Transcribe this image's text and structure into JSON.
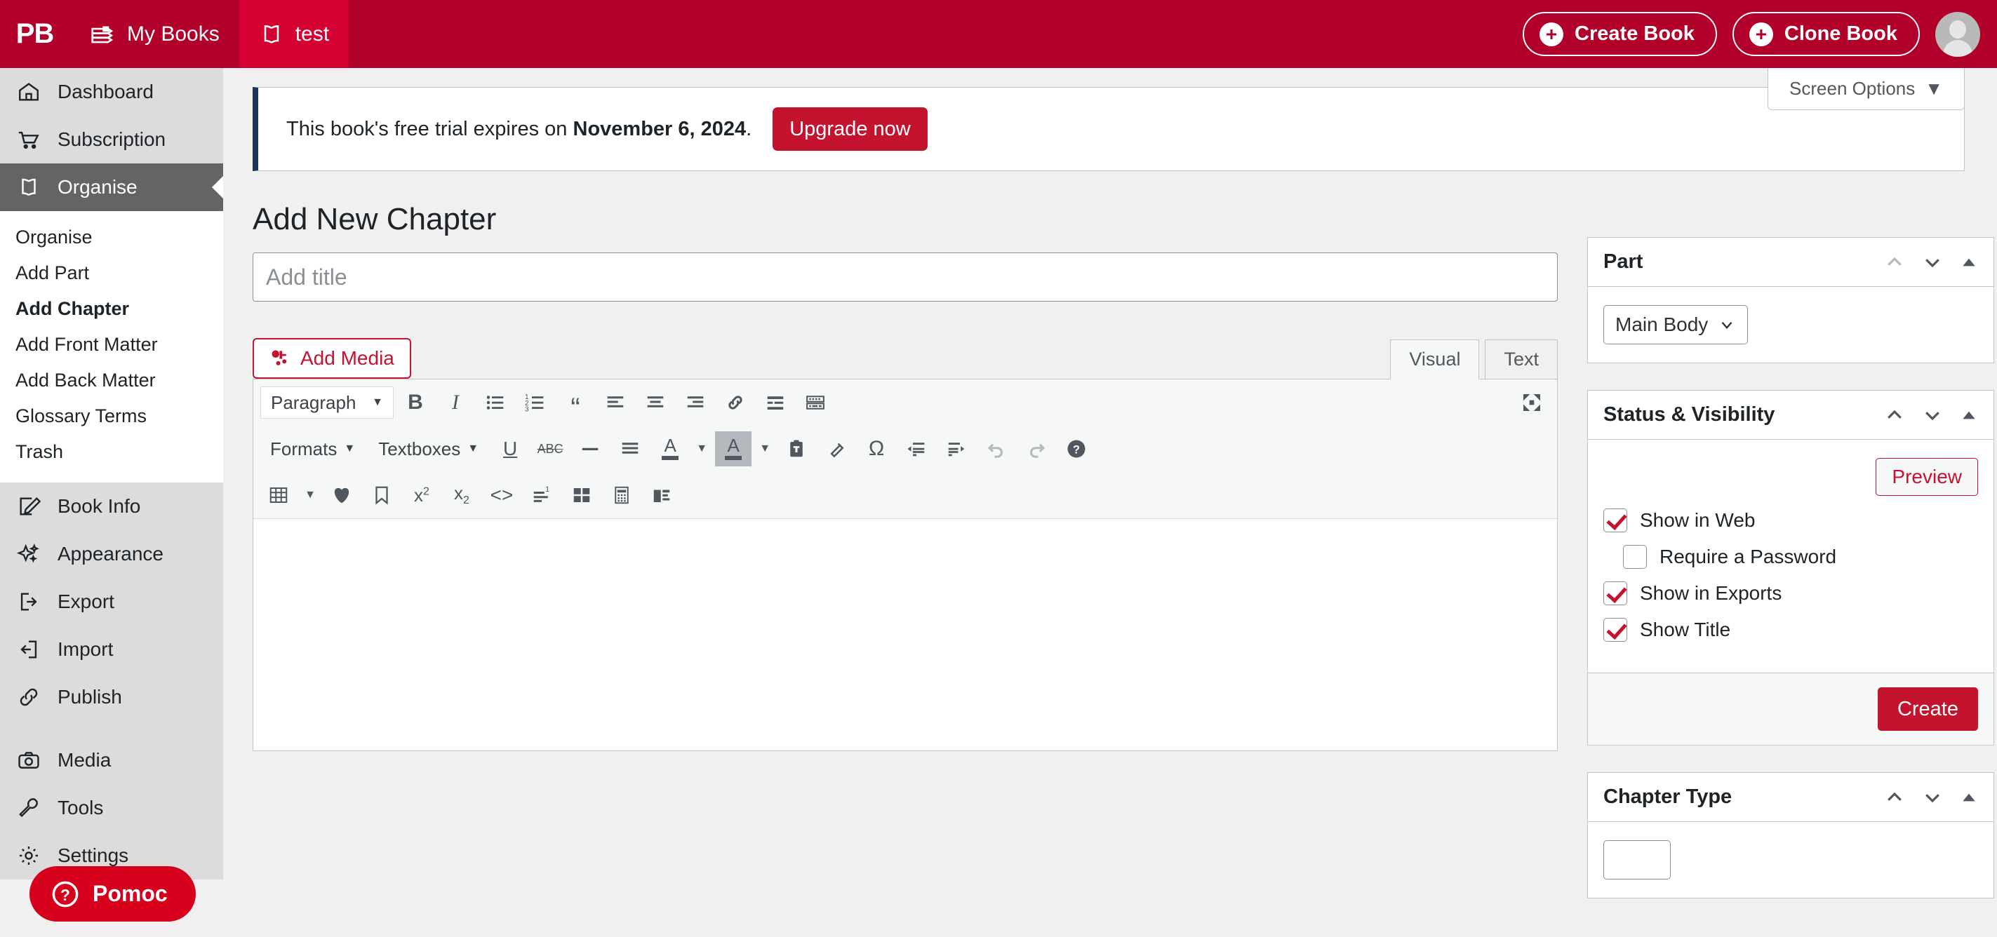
{
  "adminbar": {
    "logo": "PB",
    "items": [
      {
        "label": "My Books",
        "icon": "books-icon"
      },
      {
        "label": "test",
        "icon": "open-book-icon"
      }
    ],
    "create_book": "Create Book",
    "clone_book": "Clone Book",
    "avatar": "user-avatar",
    "brand_color": "#b10029",
    "current_color": "#d40032"
  },
  "screen_options": {
    "label": "Screen Options",
    "caret": "▼"
  },
  "sidebar": {
    "top_items": [
      {
        "label": "Dashboard",
        "icon": "home-icon"
      },
      {
        "label": "Subscription",
        "icon": "cart-icon"
      }
    ],
    "active_item": {
      "label": "Organise",
      "icon": "open-book-icon"
    },
    "submenu": [
      {
        "label": "Organise",
        "current": false
      },
      {
        "label": "Add Part",
        "current": false
      },
      {
        "label": "Add Chapter",
        "current": true
      },
      {
        "label": "Add Front Matter",
        "current": false
      },
      {
        "label": "Add Back Matter",
        "current": false
      },
      {
        "label": "Glossary Terms",
        "current": false
      },
      {
        "label": "Trash",
        "current": false
      }
    ],
    "bottom_items": [
      {
        "label": "Book Info",
        "icon": "pencil-square-icon"
      },
      {
        "label": "Appearance",
        "icon": "sparkles-icon"
      },
      {
        "label": "Export",
        "icon": "export-icon"
      },
      {
        "label": "Import",
        "icon": "import-icon"
      },
      {
        "label": "Publish",
        "icon": "link-chain-icon"
      },
      {
        "label": "Media",
        "icon": "camera-icon"
      },
      {
        "label": "Tools",
        "icon": "wrench-icon"
      },
      {
        "label": "Settings",
        "icon": "gear-icon"
      }
    ]
  },
  "notice": {
    "text_before": "This book's free trial expires on ",
    "date": "November 6, 2024",
    "text_after": ".",
    "upgrade_label": "Upgrade now",
    "accent": "#1d3557"
  },
  "page": {
    "title": "Add New Chapter"
  },
  "title_field": {
    "value": "",
    "placeholder": "Add title"
  },
  "editor": {
    "add_media": "Add Media",
    "tabs": [
      {
        "label": "Visual",
        "active": true
      },
      {
        "label": "Text",
        "active": false
      }
    ],
    "row1": {
      "format_select": "Paragraph",
      "buttons": [
        {
          "name": "bold-icon",
          "glyph": "B"
        },
        {
          "name": "italic-icon",
          "glyph": "I"
        },
        {
          "name": "bulleted-list-icon",
          "glyph": ""
        },
        {
          "name": "numbered-list-icon",
          "glyph": ""
        },
        {
          "name": "blockquote-icon",
          "glyph": "“"
        },
        {
          "name": "align-left-icon",
          "glyph": ""
        },
        {
          "name": "align-center-icon",
          "glyph": ""
        },
        {
          "name": "align-right-icon",
          "glyph": ""
        },
        {
          "name": "insert-link-icon",
          "glyph": ""
        },
        {
          "name": "read-more-icon",
          "glyph": ""
        },
        {
          "name": "keyboard-shortcuts-icon",
          "glyph": ""
        }
      ],
      "fullscreen": "fullscreen-icon"
    },
    "row2": {
      "formats_menu": "Formats",
      "textboxes_menu": "Textboxes",
      "buttons": [
        {
          "name": "underline-icon",
          "glyph": "U"
        },
        {
          "name": "strikethrough-icon",
          "glyph": "ABC"
        },
        {
          "name": "horizontal-rule-icon",
          "glyph": "—"
        },
        {
          "name": "justify-icon",
          "glyph": ""
        },
        {
          "name": "text-color-icon",
          "glyph": "A"
        },
        {
          "name": "background-color-icon",
          "glyph": "A",
          "active": true
        },
        {
          "name": "paste-as-text-icon",
          "glyph": ""
        },
        {
          "name": "clear-formatting-icon",
          "glyph": ""
        },
        {
          "name": "special-character-icon",
          "glyph": "Ω"
        },
        {
          "name": "outdent-icon",
          "glyph": ""
        },
        {
          "name": "indent-icon",
          "glyph": ""
        },
        {
          "name": "undo-icon",
          "glyph": "",
          "disabled": true
        },
        {
          "name": "redo-icon",
          "glyph": "",
          "disabled": true
        },
        {
          "name": "help-icon",
          "glyph": "?"
        }
      ]
    },
    "row3": {
      "buttons": [
        {
          "name": "table-icon",
          "glyph": ""
        },
        {
          "name": "glossary-term-icon",
          "glyph": ""
        },
        {
          "name": "anchor-bookmark-icon",
          "glyph": ""
        },
        {
          "name": "superscript-icon",
          "glyph": "x²"
        },
        {
          "name": "subscript-icon",
          "glyph": "x₂"
        },
        {
          "name": "source-code-icon",
          "glyph": "<>"
        },
        {
          "name": "footnote-icon",
          "glyph": ""
        },
        {
          "name": "blocks-icon",
          "glyph": ""
        },
        {
          "name": "math-icon",
          "glyph": ""
        },
        {
          "name": "media-layout-icon",
          "glyph": ""
        }
      ]
    }
  },
  "panels": {
    "part": {
      "title": "Part",
      "select_value": "Main Body",
      "actions": {
        "up": "▲",
        "down": "▼",
        "toggle": "▲"
      }
    },
    "status": {
      "title": "Status & Visibility",
      "preview_label": "Preview",
      "checkboxes": [
        {
          "label": "Show in Web",
          "checked": true,
          "indent": false
        },
        {
          "label": "Require a Password",
          "checked": false,
          "indent": true
        },
        {
          "label": "Show in Exports",
          "checked": true,
          "indent": false
        },
        {
          "label": "Show Title",
          "checked": true,
          "indent": false
        }
      ],
      "create_label": "Create"
    },
    "chapter_type": {
      "title": "Chapter Type",
      "actions": {
        "up": "▲",
        "down": "▼",
        "toggle": "▲"
      }
    }
  },
  "pomoc": {
    "label": "Pomoc",
    "icon": "help-circle-icon",
    "color": "#d6001c"
  }
}
